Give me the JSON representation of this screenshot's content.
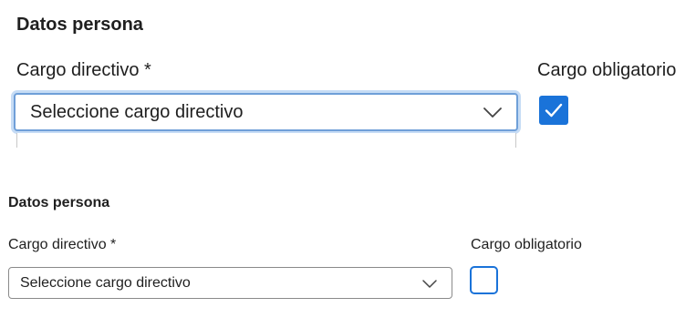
{
  "top": {
    "section_title": "Datos persona",
    "cargo_label": "Cargo directivo *",
    "select_placeholder": "Seleccione cargo directivo",
    "obligatorio_label": "Cargo obligatorio",
    "obligatorio_checked": true,
    "select_focused": true,
    "dropdown_open": true
  },
  "bottom": {
    "section_title": "Datos persona",
    "cargo_label": "Cargo directivo *",
    "select_placeholder": "Seleccione cargo directivo",
    "obligatorio_label": "Cargo obligatorio",
    "obligatorio_checked": false
  },
  "colors": {
    "accent": "#1a73d9",
    "focus_ring": "#6f9fd8",
    "border": "#8a8a8a",
    "text": "#1f1f1f"
  },
  "icons": {
    "select_arrow": "chevron-down-icon",
    "checkbox_mark": "checkmark-icon"
  }
}
